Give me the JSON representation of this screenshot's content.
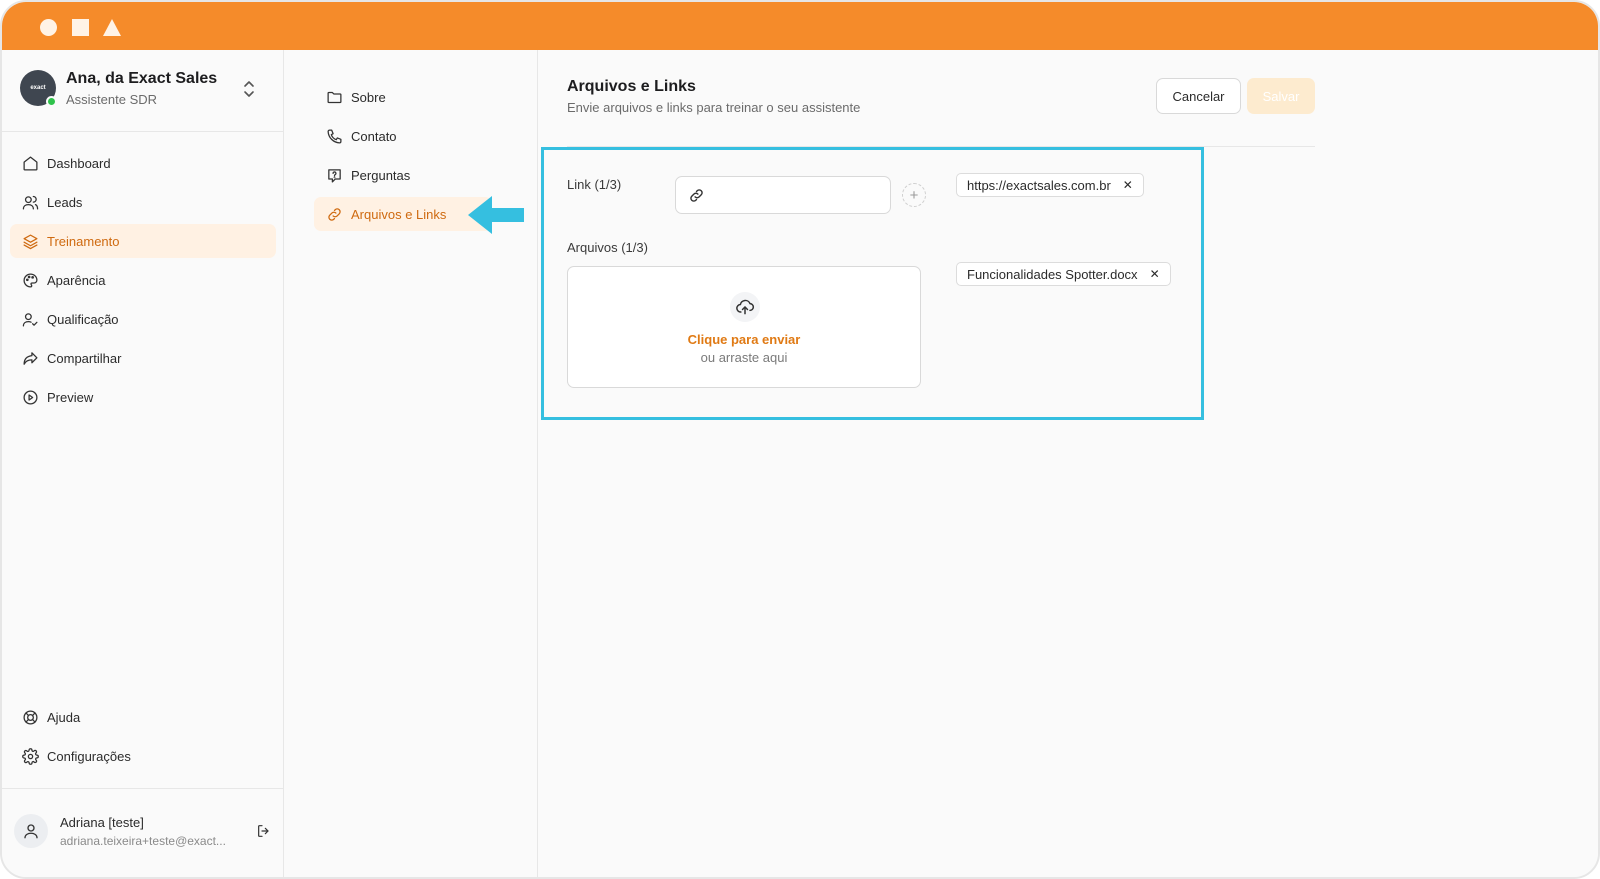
{
  "window": {
    "titlebar_color": "#f58b2a",
    "controls": [
      "circle-icon",
      "square-icon",
      "triangle-icon"
    ]
  },
  "sidebar": {
    "brand": {
      "avatar_text": "exact",
      "name": "Ana, da Exact Sales",
      "role": "Assistente SDR",
      "status_color": "#2fc24b"
    },
    "items": [
      {
        "label": "Dashboard",
        "icon": "home-icon"
      },
      {
        "label": "Leads",
        "icon": "users-icon"
      },
      {
        "label": "Treinamento",
        "icon": "layers-icon",
        "active": true
      },
      {
        "label": "Aparência",
        "icon": "palette-icon"
      },
      {
        "label": "Qualificação",
        "icon": "user-check-icon"
      },
      {
        "label": "Compartilhar",
        "icon": "share-icon"
      },
      {
        "label": "Preview",
        "icon": "play-circle-icon"
      }
    ],
    "bottom_items": [
      {
        "label": "Ajuda",
        "icon": "lifebuoy-icon"
      },
      {
        "label": "Configurações",
        "icon": "gear-icon"
      }
    ],
    "user": {
      "name": "Adriana [teste]",
      "email": "adriana.teixeira+teste@exact..."
    }
  },
  "subnav": {
    "items": [
      {
        "label": "Sobre",
        "icon": "folder-icon"
      },
      {
        "label": "Contato",
        "icon": "phone-icon"
      },
      {
        "label": "Perguntas",
        "icon": "question-icon"
      },
      {
        "label": "Arquivos e Links",
        "icon": "link-icon",
        "active": true
      }
    ],
    "pointer_color": "#35bfe0"
  },
  "main": {
    "title": "Arquivos e Links",
    "subtitle": "Envie arquivos e links para treinar o seu assistente",
    "cancel_label": "Cancelar",
    "save_label": "Salvar",
    "accent": "#e07a14",
    "link_section": {
      "label": "Link (1/3)",
      "input_value": "",
      "tags": [
        "https://exactsales.com.br"
      ]
    },
    "files_section": {
      "label": "Arquivos (1/3)",
      "dropzone_click": "Clique para enviar",
      "dropzone_or": "ou arraste aqui",
      "tags": [
        "Funcionalidades Spotter.docx"
      ]
    }
  }
}
